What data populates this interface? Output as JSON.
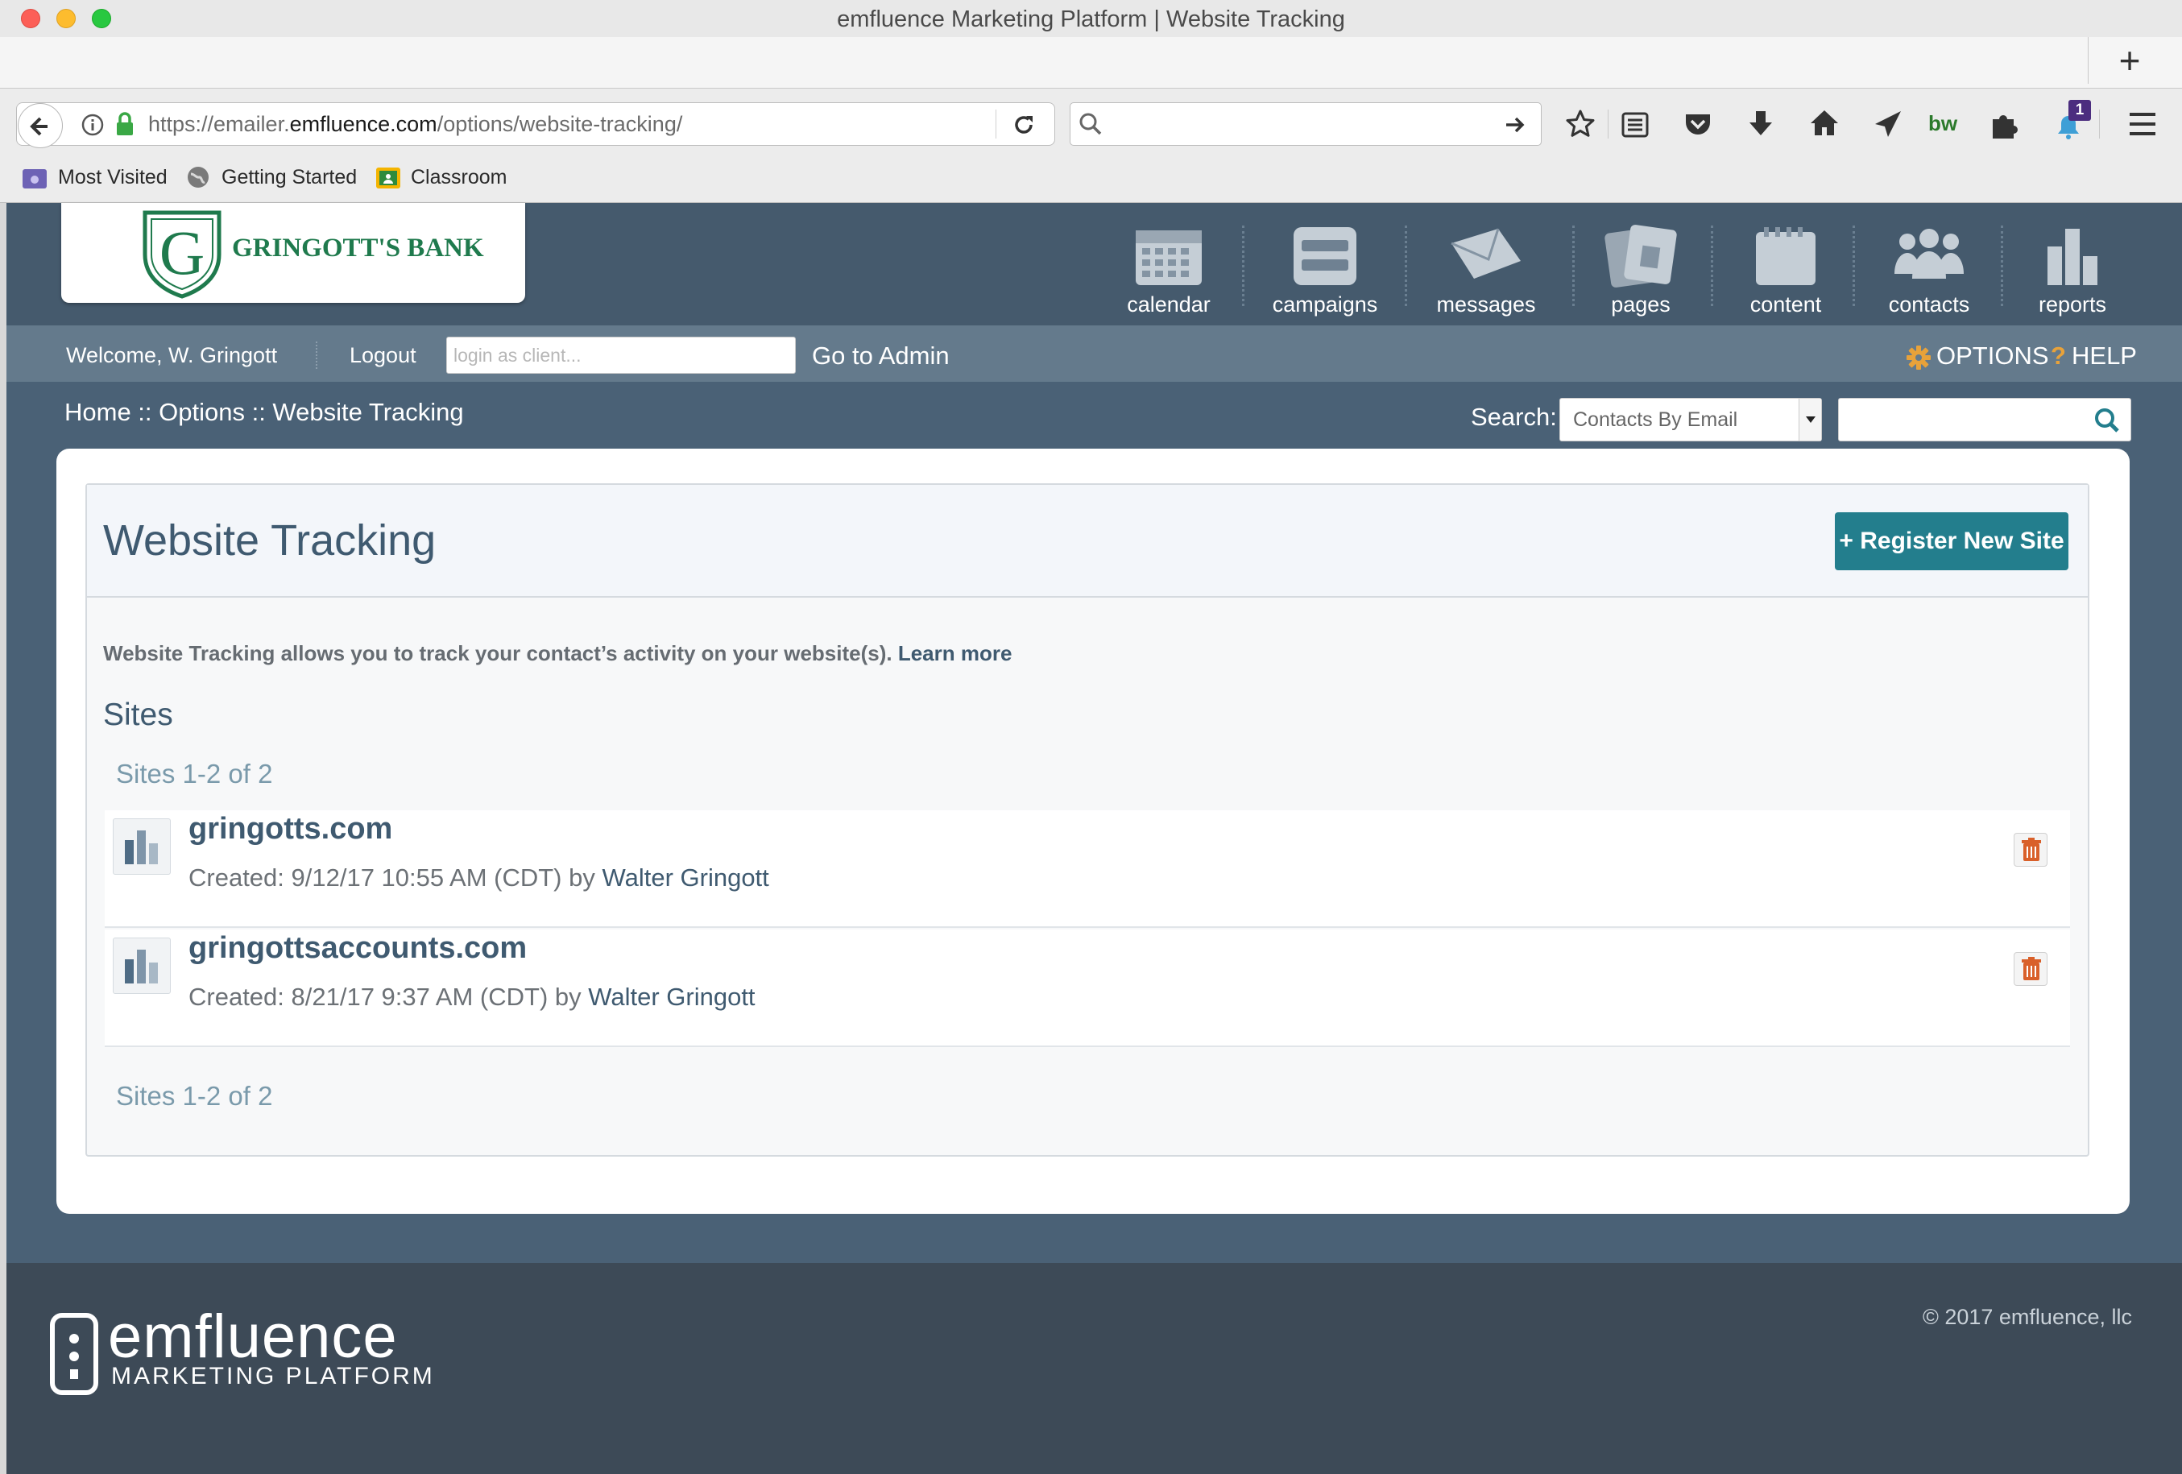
{
  "window": {
    "title": "emfluence Marketing Platform | Website Tracking"
  },
  "browser": {
    "url_prefix": "https://emailer.",
    "url_domain": "emfluence.com",
    "url_path": "/options/website-tracking/",
    "notification_count": "1",
    "bookmarks": [
      "Most Visited",
      "Getting Started",
      "Classroom"
    ]
  },
  "brand": {
    "name": "GRINGOTT'S BANK",
    "letter": "G",
    "accent": "#1f7a4d"
  },
  "nav": {
    "items": [
      {
        "label": "calendar"
      },
      {
        "label": "campaigns"
      },
      {
        "label": "messages"
      },
      {
        "label": "pages"
      },
      {
        "label": "content"
      },
      {
        "label": "contacts"
      },
      {
        "label": "reports"
      }
    ]
  },
  "userbar": {
    "welcome": "Welcome, W. Gringott",
    "logout": "Logout",
    "client_placeholder": "login as client...",
    "admin": "Go to Admin",
    "options": "OPTIONS",
    "help": "HELP"
  },
  "breadcrumb": {
    "text": "Home :: Options :: Website Tracking"
  },
  "search": {
    "label": "Search:",
    "selected": "Contacts By Email",
    "value": ""
  },
  "page": {
    "title": "Website Tracking",
    "register_button": "Register New Site",
    "register_plus": "+",
    "description": "Website Tracking allows you to track your contact’s activity on your website(s).",
    "learn_more": "Learn more",
    "sites_heading": "Sites",
    "pager_top": "Sites 1-2 of 2",
    "pager_bottom": "Sites 1-2 of 2",
    "sites": [
      {
        "name": "gringotts.com",
        "created": "Created: 9/12/17 10:55 AM (CDT) by",
        "author": "Walter Gringott"
      },
      {
        "name": "gringottsaccounts.com",
        "created": "Created: 8/21/17 9:37 AM (CDT) by",
        "author": "Walter Gringott"
      }
    ]
  },
  "footer": {
    "brand": "emfluence",
    "tagline": "MARKETING PLATFORM",
    "copyright": "© 2017 emfluence, llc"
  },
  "colors": {
    "header": "#455a6d",
    "accent_button": "#237e8d",
    "trash": "#d9602a",
    "options_gear": "#e8a23a"
  }
}
